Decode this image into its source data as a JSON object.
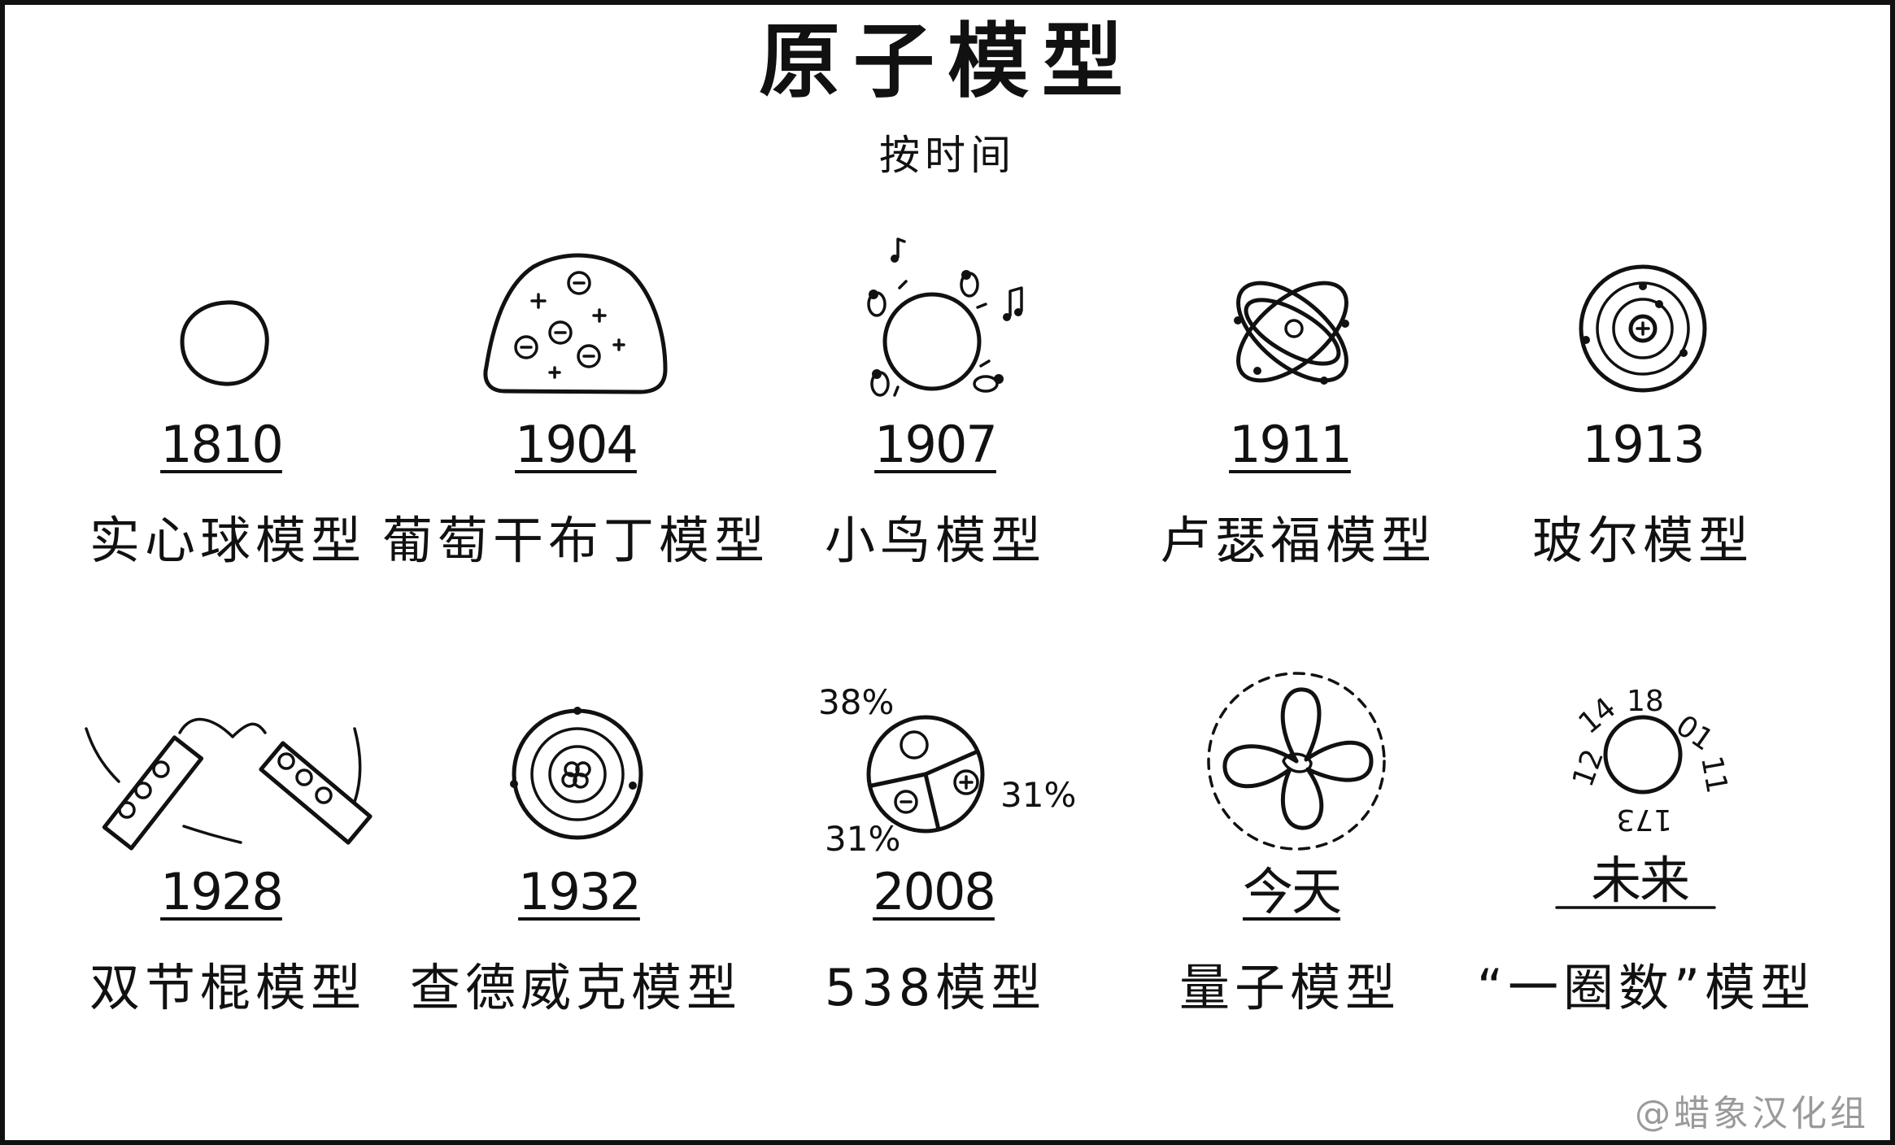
{
  "title": "原子模型",
  "subtitle": "按时间",
  "models": [
    {
      "year": "1810",
      "name": "实心球模型",
      "icon": "solid-sphere"
    },
    {
      "year": "1904",
      "name": "葡萄干布丁模型",
      "icon": "plum-pudding"
    },
    {
      "year": "1907",
      "name": "小鸟模型",
      "icon": "little-bird"
    },
    {
      "year": "1911",
      "name": "卢瑟福模型",
      "icon": "rutherford-orbits"
    },
    {
      "year": "1913",
      "name": "玻尔模型",
      "icon": "bohr-rings"
    },
    {
      "year": "1928",
      "name": "双节棍模型",
      "icon": "nunchaku"
    },
    {
      "year": "1932",
      "name": "查德威克模型",
      "icon": "chadwick-nucleus"
    },
    {
      "year": "2008",
      "name": "538模型",
      "icon": "pie-chart"
    },
    {
      "year": "今天",
      "name": "量子模型",
      "icon": "quantum-cloud"
    },
    {
      "year": "未来",
      "name": "“一圈数”模型",
      "icon": "number-circle"
    }
  ],
  "pie_labels": [
    "38%",
    "31%",
    "31%"
  ],
  "clock_numbers": [
    "18",
    "01",
    "11",
    "173",
    "12",
    "14"
  ],
  "credit": "@蜡象汉化组"
}
